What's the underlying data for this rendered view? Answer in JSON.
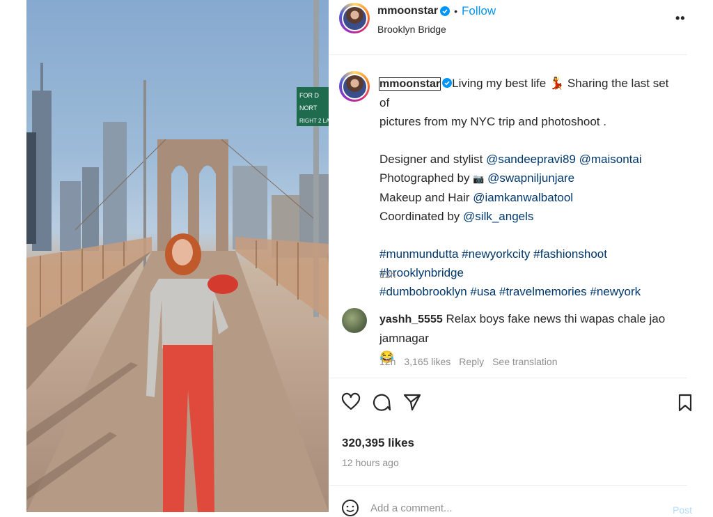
{
  "post": {
    "author": "mmoonstar",
    "follow_label": "Follow",
    "location": "Brooklyn Bridge",
    "more_label": "••"
  },
  "caption": {
    "username": "mmoonstar",
    "lines": [
      [
        "Living my best life ",
        "💃",
        " Sharing the last set of"
      ],
      "pictures from my NYC trip and photoshoot ."
    ],
    "line1_a": "Living my best life ",
    "line1_emoji": "💃",
    "line1_b": " Sharing the last set of",
    "line2": "pictures from my NYC trip and photoshoot .",
    "credit1_prefix": "Designer and stylist ",
    "credit1_m1": "@sandeepravi89",
    "credit1_m2": "@maisontai",
    "credit2_prefix": "Photographed by ",
    "credit2_emoji": "📷",
    "credit2_m": "@swapniljunjare",
    "credit3_prefix": "Makeup and Hair ",
    "credit3_m": "@iamkanwalbatool",
    "credit4_prefix": "Coordinated by ",
    "credit4_m": "@silk_angels",
    "hashtags_line1": "#munmundutta #newyorkcity #fashionshoot #brooklynbridge",
    "hashtags_line2": "#dumbobrooklyn #usa #travelmemories #newyork",
    "time": "12h"
  },
  "comment": {
    "username": "yashh_5555",
    "text": "Relax boys fake news thi wapas chale jao jamnagar",
    "emoji": "😂",
    "time": "12h",
    "likes": "3,165 likes",
    "reply_label": "Reply",
    "translate_label": "See translation"
  },
  "stats": {
    "likes": "320,395 likes",
    "posted": "12 hours ago"
  },
  "composer": {
    "placeholder": "Add a comment...",
    "post_label": "Post"
  },
  "photo": {
    "sign_text": [
      "FOR D",
      "NORT",
      "RIGHT 2 LA"
    ]
  },
  "colors": {
    "link": "#0095f6",
    "mention": "#00376b",
    "muted": "#8e8e8e"
  }
}
